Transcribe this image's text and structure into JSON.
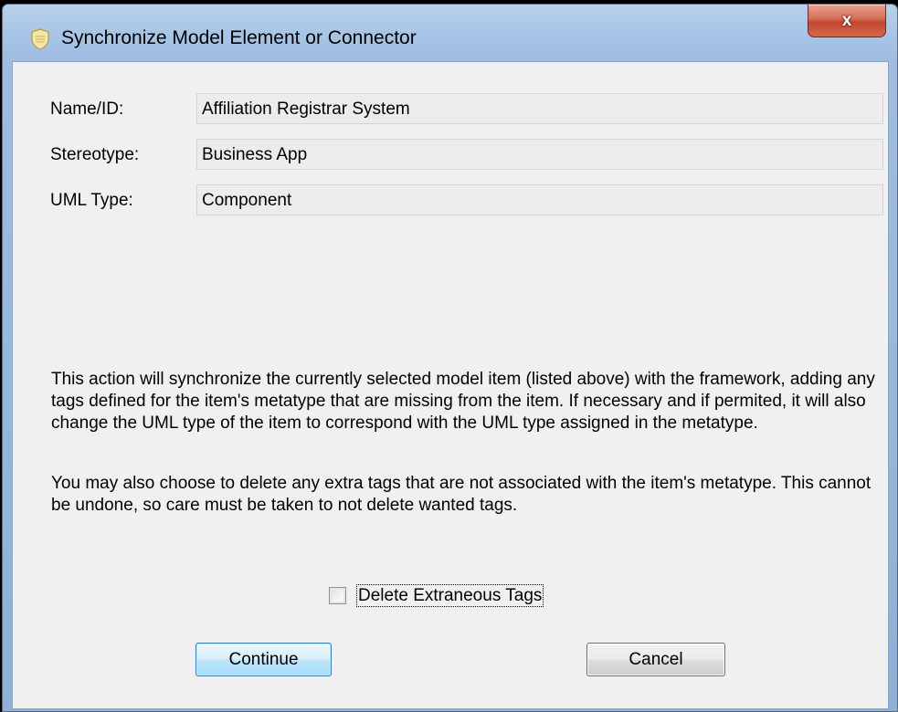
{
  "window": {
    "title": "Synchronize Model Element or Connector",
    "close_label": "x"
  },
  "fields": [
    {
      "label": "Name/ID:",
      "value": "Affiliation Registrar System"
    },
    {
      "label": "Stereotype:",
      "value": "Business App"
    },
    {
      "label": "UML Type:",
      "value": "Component"
    }
  ],
  "description": {
    "paragraph1": "This action will synchronize the currently selected model item (listed above) with the framework, adding any tags defined for the item's metatype that are missing from the item. If necessary and if permited, it will also change the UML type of the item to correspond with the UML type assigned in the metatype.",
    "paragraph2": "You may also choose to delete any extra tags that are not associated with the item's metatype. This cannot be undone, so care must be taken to not delete wanted tags."
  },
  "delete_extraneous": {
    "label": "Delete Extraneous Tags",
    "checked": false
  },
  "buttons": {
    "continue": "Continue",
    "cancel": "Cancel"
  },
  "icons": {
    "title": "shield-app-icon",
    "close": "close-icon"
  }
}
